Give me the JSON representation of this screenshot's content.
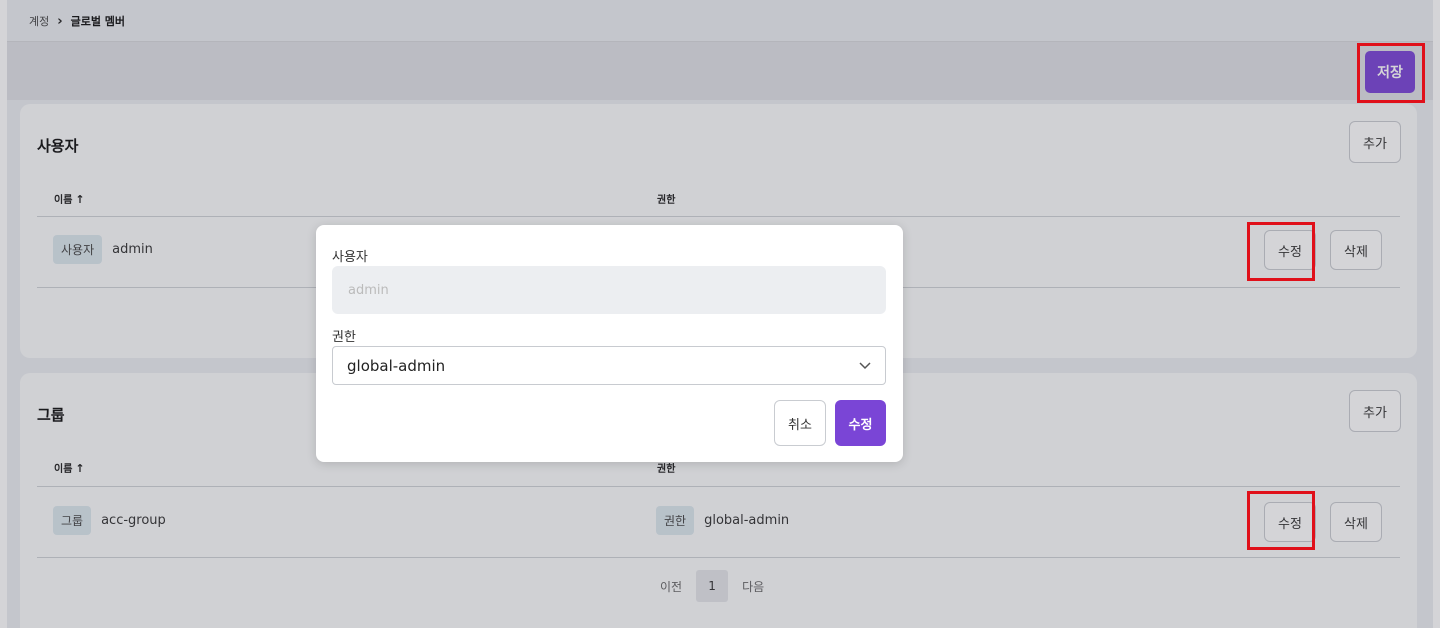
{
  "breadcrumb": {
    "root": "계정",
    "separator": "›",
    "current": "글로벌 멤버"
  },
  "toolbar": {
    "save_label": "저장"
  },
  "users_section": {
    "title": "사용자",
    "add_label": "추가",
    "columns": {
      "name": "이름",
      "name_sort_icon": "↑",
      "permission": "권한"
    },
    "rows": [
      {
        "type_tag": "사용자",
        "name": "admin",
        "edit_label": "수정",
        "delete_label": "삭제"
      }
    ]
  },
  "groups_section": {
    "title": "그룹",
    "add_label": "추가",
    "columns": {
      "name": "이름",
      "name_sort_icon": "↑",
      "permission": "권한"
    },
    "rows": [
      {
        "type_tag": "그룹",
        "name": "acc-group",
        "permission_tag": "권한",
        "permission": "global-admin",
        "edit_label": "수정",
        "delete_label": "삭제"
      }
    ],
    "pagination": {
      "prev": "이전",
      "current": "1",
      "next": "다음"
    }
  },
  "modal": {
    "user_label": "사용자",
    "user_value": "admin",
    "permission_label": "권한",
    "permission_selected": "global-admin",
    "chevron_icon": "chevron-down-icon",
    "cancel_label": "취소",
    "submit_label": "수정"
  },
  "colors": {
    "accent": "#7a45d6",
    "highlight": "#e0101a",
    "tag_bg": "#dbe8ee"
  }
}
